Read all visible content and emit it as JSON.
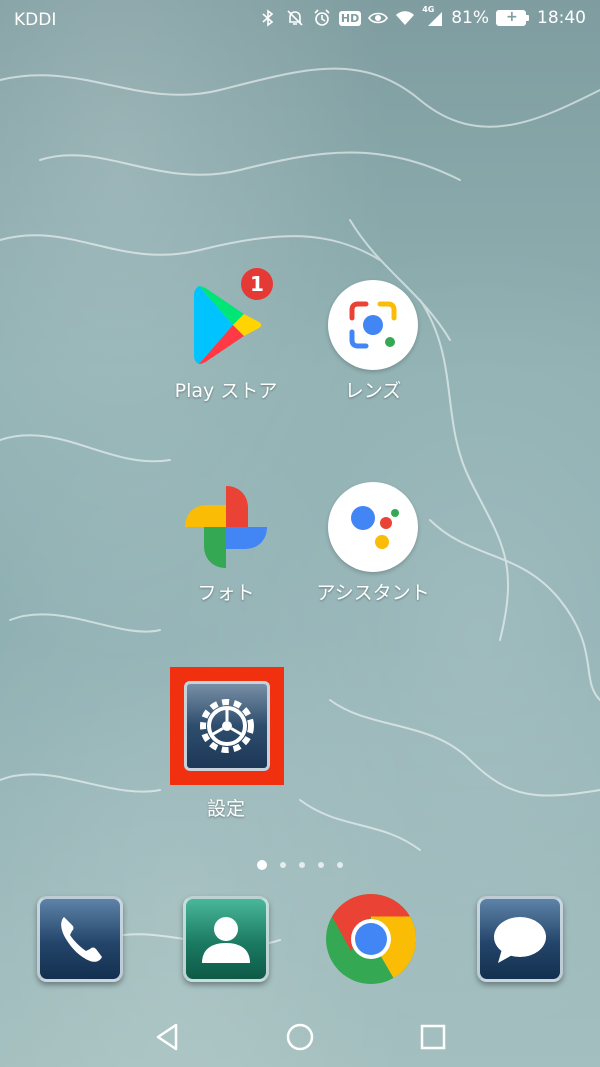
{
  "status_bar": {
    "carrier": "KDDI",
    "hd": "HD",
    "network": "4G",
    "battery_percent": "81%",
    "time": "18:40",
    "icons": [
      "bluetooth-icon",
      "mute-icon",
      "alarm-icon",
      "hd-icon",
      "eye-comfort-icon",
      "wifi-icon",
      "signal-icon",
      "battery-icon"
    ]
  },
  "apps": [
    {
      "label": "Play ストア",
      "icon": "play-store-icon",
      "badge": "1"
    },
    {
      "label": "レンズ",
      "icon": "lens-icon"
    },
    {
      "label": "フォト",
      "icon": "photos-icon"
    },
    {
      "label": "アシスタント",
      "icon": "assistant-icon"
    },
    {
      "label": "設定",
      "icon": "settings-gear-icon",
      "highlighted": true,
      "highlight_color": "#f0300f"
    }
  ],
  "page_indicator": {
    "pages": 5,
    "current": 1
  },
  "dock": [
    {
      "app": "phone",
      "icon": "phone-icon"
    },
    {
      "app": "contacts",
      "icon": "contacts-icon"
    },
    {
      "app": "chrome",
      "icon": "chrome-icon"
    },
    {
      "app": "messages",
      "icon": "message-icon"
    }
  ],
  "nav_bar": [
    "back-icon",
    "home-icon",
    "recents-icon"
  ],
  "colors": {
    "badge": "#e53935",
    "google_blue": "#4285f4",
    "google_red": "#ea4335",
    "google_yellow": "#fbbc05",
    "google_green": "#34a853"
  }
}
